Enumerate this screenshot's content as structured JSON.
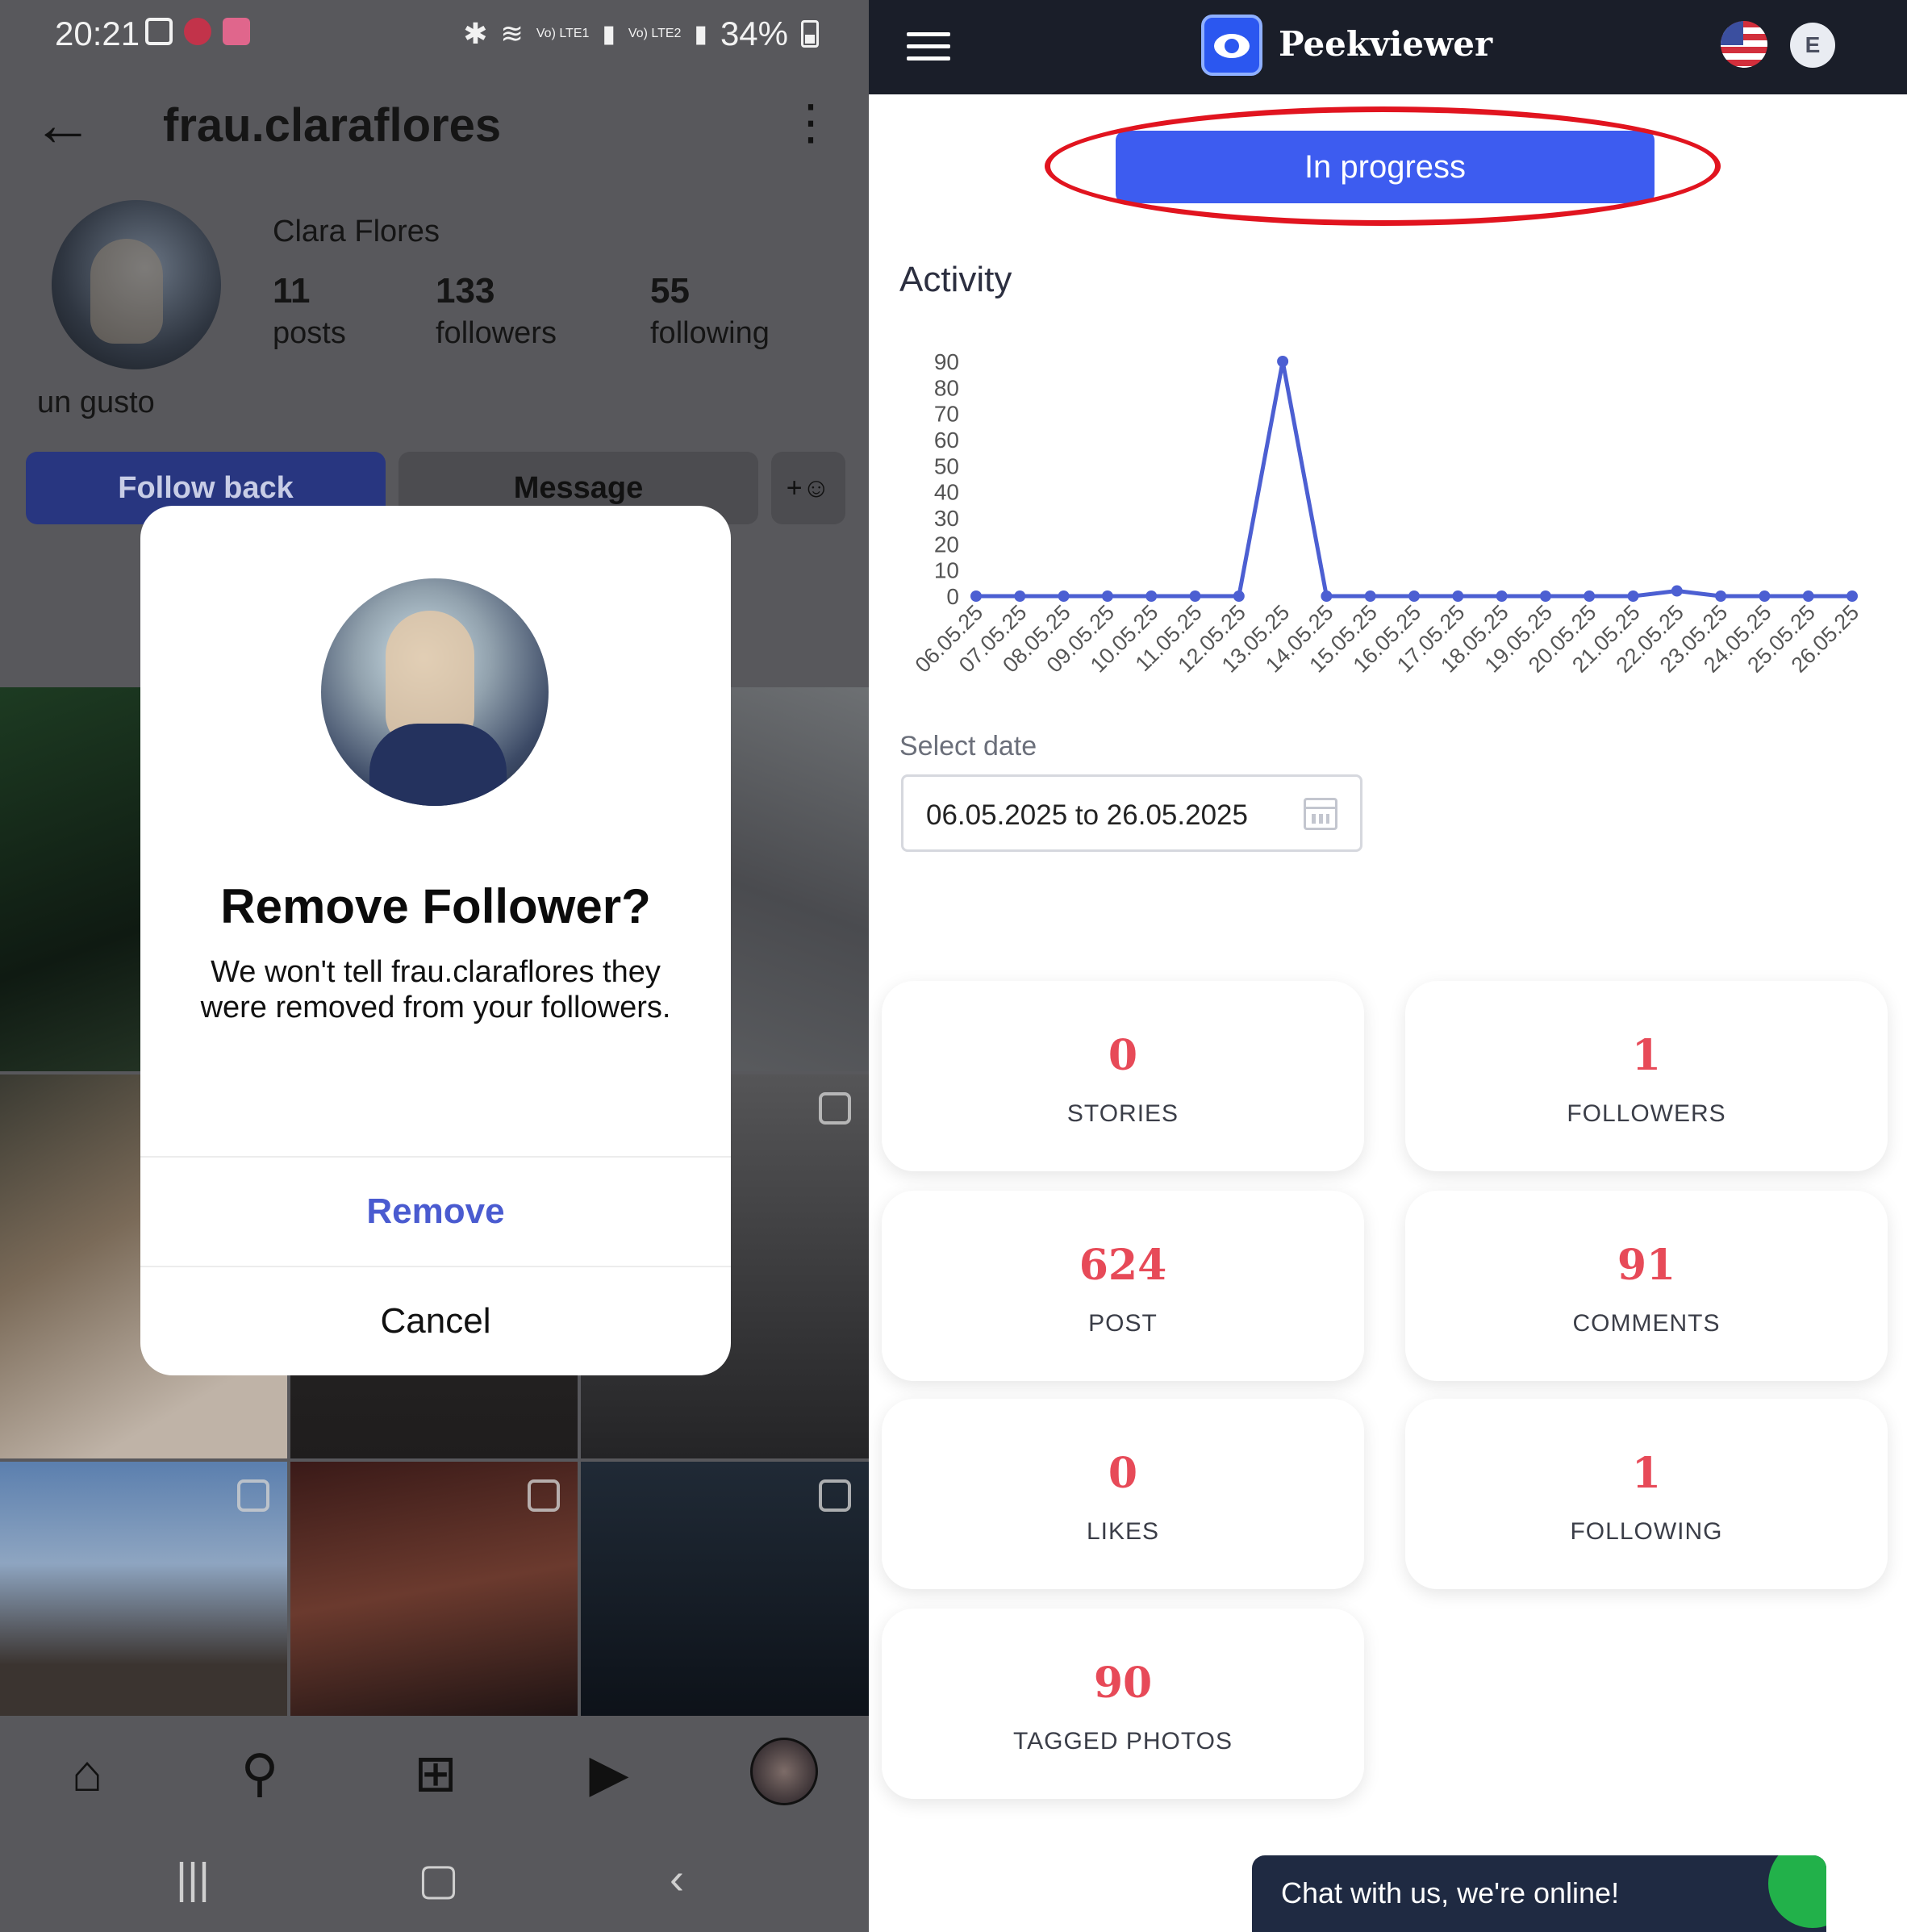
{
  "left": {
    "status": {
      "time": "20:21",
      "battery": "34%",
      "sim1": "Vo) LTE1",
      "sim2": "Vo) LTE2"
    },
    "header": {
      "username": "frau.claraflores"
    },
    "profile": {
      "full_name": "Clara Flores",
      "posts": {
        "num": "11",
        "label": "posts"
      },
      "followers": {
        "num": "133",
        "label": "followers"
      },
      "following": {
        "num": "55",
        "label": "following"
      },
      "bio": "un gusto"
    },
    "buttons": {
      "follow_back": "Follow back",
      "message": "Message",
      "add_user_icon": "add-person-icon"
    },
    "dialog": {
      "title": "Remove Follower?",
      "body": "We won't tell frau.claraflores they were removed from your followers.",
      "remove": "Remove",
      "cancel": "Cancel"
    },
    "bottom_nav": [
      "home-icon",
      "search-icon",
      "create-icon",
      "reels-icon",
      "profile-avatar"
    ],
    "system_nav": [
      "recents-icon",
      "home-icon",
      "back-icon"
    ]
  },
  "right": {
    "brand": "Peekviewer",
    "avatar_initial": "E",
    "status_button": "In progress",
    "activity_title": "Activity",
    "select_date_label": "Select date",
    "date_range": "06.05.2025 to 26.05.2025",
    "stats": [
      {
        "value": "0",
        "label": "STORIES"
      },
      {
        "value": "1",
        "label": "FOLLOWERS"
      },
      {
        "value": "624",
        "label": "POST"
      },
      {
        "value": "91",
        "label": "COMMENTS"
      },
      {
        "value": "0",
        "label": "LIKES"
      },
      {
        "value": "1",
        "label": "FOLLOWING"
      },
      {
        "value": "90",
        "label": "TAGGED PHOTOS"
      }
    ],
    "chat": "Chat with us, we're online!",
    "colors": {
      "accent": "#3d5cf0",
      "stat_red": "#e74a58",
      "header_bg": "#1a1e29",
      "line": "#4c5fd2"
    }
  },
  "chart_data": {
    "type": "line",
    "title": "Activity",
    "x": [
      "06.05.25",
      "07.05.25",
      "08.05.25",
      "09.05.25",
      "10.05.25",
      "11.05.25",
      "12.05.25",
      "13.05.25",
      "14.05.25",
      "15.05.25",
      "16.05.25",
      "17.05.25",
      "18.05.25",
      "19.05.25",
      "20.05.25",
      "21.05.25",
      "22.05.25",
      "23.05.25",
      "24.05.25",
      "25.05.25",
      "26.05.25"
    ],
    "y": [
      0,
      0,
      0,
      0,
      0,
      0,
      0,
      90,
      0,
      0,
      0,
      0,
      0,
      0,
      0,
      0,
      2,
      0,
      0,
      0,
      0
    ],
    "yticks": [
      0,
      10,
      20,
      30,
      40,
      50,
      60,
      70,
      80,
      90
    ],
    "ylim": [
      0,
      90
    ],
    "grid": false
  }
}
